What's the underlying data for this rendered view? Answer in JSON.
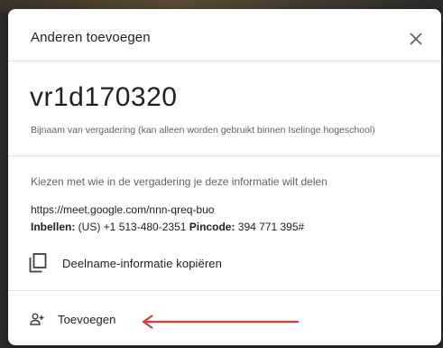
{
  "dialog": {
    "title": "Anderen toevoegen",
    "close_icon": "close-icon"
  },
  "meeting": {
    "code": "vr1d170320",
    "nickname_note": "Bijnaam van vergadering (kan alleen worden gebruikt binnen Iselinge hogeschool)"
  },
  "info": {
    "heading": "Kiezen met wie in de vergadering je deze informatie wilt delen",
    "meet_link": "https://meet.google.com/nnn-qreq-buo",
    "dialin_label": "Inbellen:",
    "dialin_number": " (US) +1 513-480-2351 ",
    "pincode_label": "Pincode:",
    "pincode_value": " 394 771 395#",
    "copy_icon": "copy-icon",
    "copy_label": "Deelname-informatie kopiëren"
  },
  "footer": {
    "add_icon": "person-add-icon",
    "add_label": "Toevoegen"
  },
  "annotation": {
    "arrow_color": "#e53935"
  }
}
